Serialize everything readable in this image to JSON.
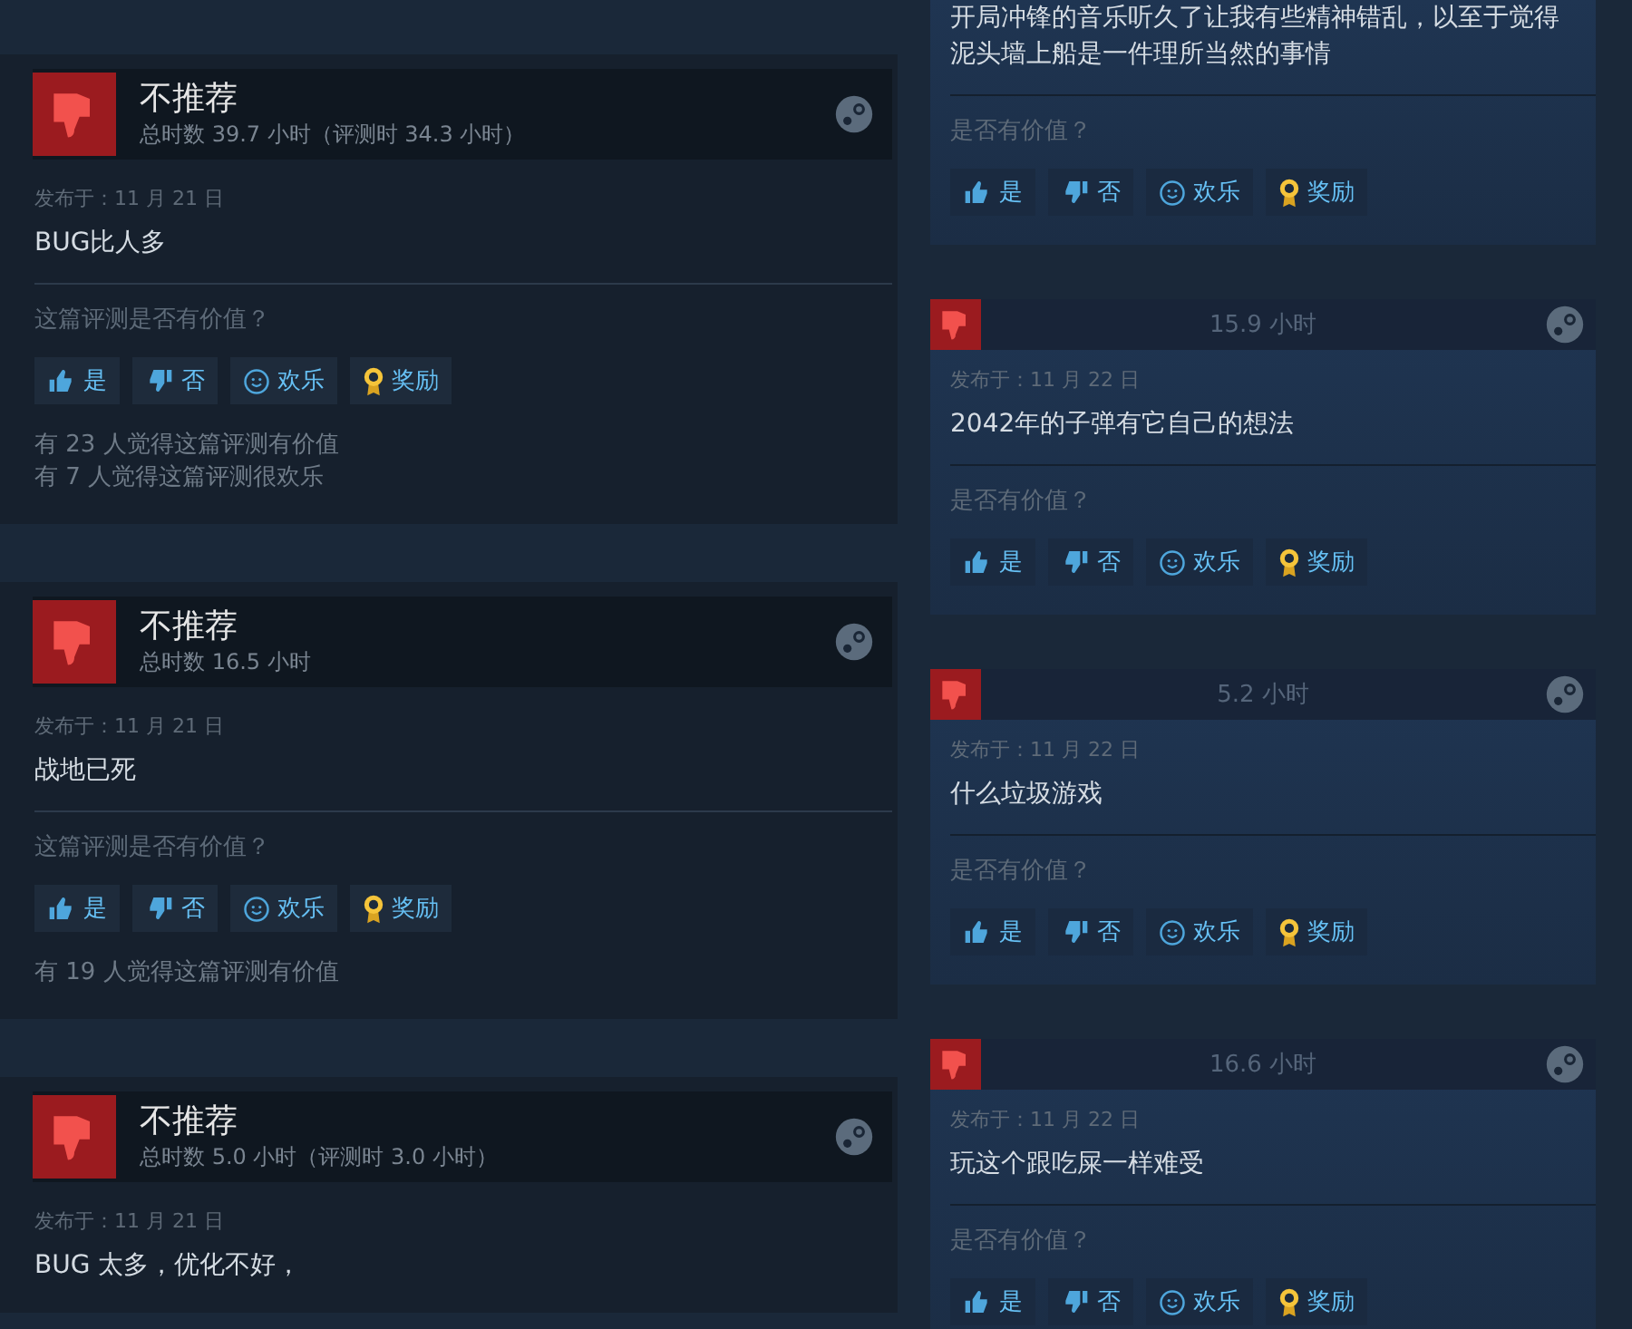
{
  "left_reviews": [
    {
      "verdict": "不推荐",
      "hours": "总时数 39.7 小时（评测时 34.3 小时）",
      "posted": "发布于：11 月 21 日",
      "text": "BUG比人多",
      "question": "这篇评测是否有价值？",
      "buttons": [
        {
          "kind": "yes",
          "label": "是"
        },
        {
          "kind": "no",
          "label": "否"
        },
        {
          "kind": "funny",
          "label": "欢乐"
        },
        {
          "kind": "award",
          "label": "奖励"
        }
      ],
      "stats": [
        "有 23 人觉得这篇评测有价值",
        "有 7 人觉得这篇评测很欢乐"
      ]
    },
    {
      "verdict": "不推荐",
      "hours": "总时数 16.5 小时",
      "posted": "发布于：11 月 21 日",
      "text": "战地已死",
      "question": "这篇评测是否有价值？",
      "buttons": [
        {
          "kind": "yes",
          "label": "是"
        },
        {
          "kind": "no",
          "label": "否"
        },
        {
          "kind": "funny",
          "label": "欢乐"
        },
        {
          "kind": "award",
          "label": "奖励"
        }
      ],
      "stats": [
        "有 19 人觉得这篇评测有价值"
      ]
    },
    {
      "verdict": "不推荐",
      "hours": "总时数 5.0 小时（评测时 3.0 小时）",
      "posted": "发布于：11 月 21 日",
      "text": "BUG 太多，优化不好，"
    }
  ],
  "right_reviews": [
    {
      "text": "开局冲锋的音乐听久了让我有些精神错乱，以至于觉得泥头墙上船是一件理所当然的事情",
      "question": "是否有价值？",
      "buttons": [
        {
          "kind": "yes",
          "label": "是"
        },
        {
          "kind": "no",
          "label": "否"
        },
        {
          "kind": "funny",
          "label": "欢乐"
        },
        {
          "kind": "award",
          "label": "奖励"
        }
      ]
    },
    {
      "hours": "15.9 小时",
      "posted": "发布于：11 月 22 日",
      "text": "2042年的子弹有它自己的想法",
      "question": "是否有价值？",
      "buttons": [
        {
          "kind": "yes",
          "label": "是"
        },
        {
          "kind": "no",
          "label": "否"
        },
        {
          "kind": "funny",
          "label": "欢乐"
        },
        {
          "kind": "award",
          "label": "奖励"
        }
      ]
    },
    {
      "hours": "5.2 小时",
      "posted": "发布于：11 月 22 日",
      "text": "什么垃圾游戏",
      "question": "是否有价值？",
      "buttons": [
        {
          "kind": "yes",
          "label": "是"
        },
        {
          "kind": "no",
          "label": "否"
        },
        {
          "kind": "funny",
          "label": "欢乐"
        },
        {
          "kind": "award",
          "label": "奖励"
        }
      ]
    },
    {
      "hours": "16.6 小时",
      "posted": "发布于：11 月 22 日",
      "text": "玩这个跟吃屎一样难受",
      "question": "是否有价值？",
      "buttons": [
        {
          "kind": "yes",
          "label": "是"
        },
        {
          "kind": "no",
          "label": "否"
        },
        {
          "kind": "funny",
          "label": "欢乐"
        },
        {
          "kind": "award",
          "label": "奖励"
        }
      ]
    }
  ]
}
